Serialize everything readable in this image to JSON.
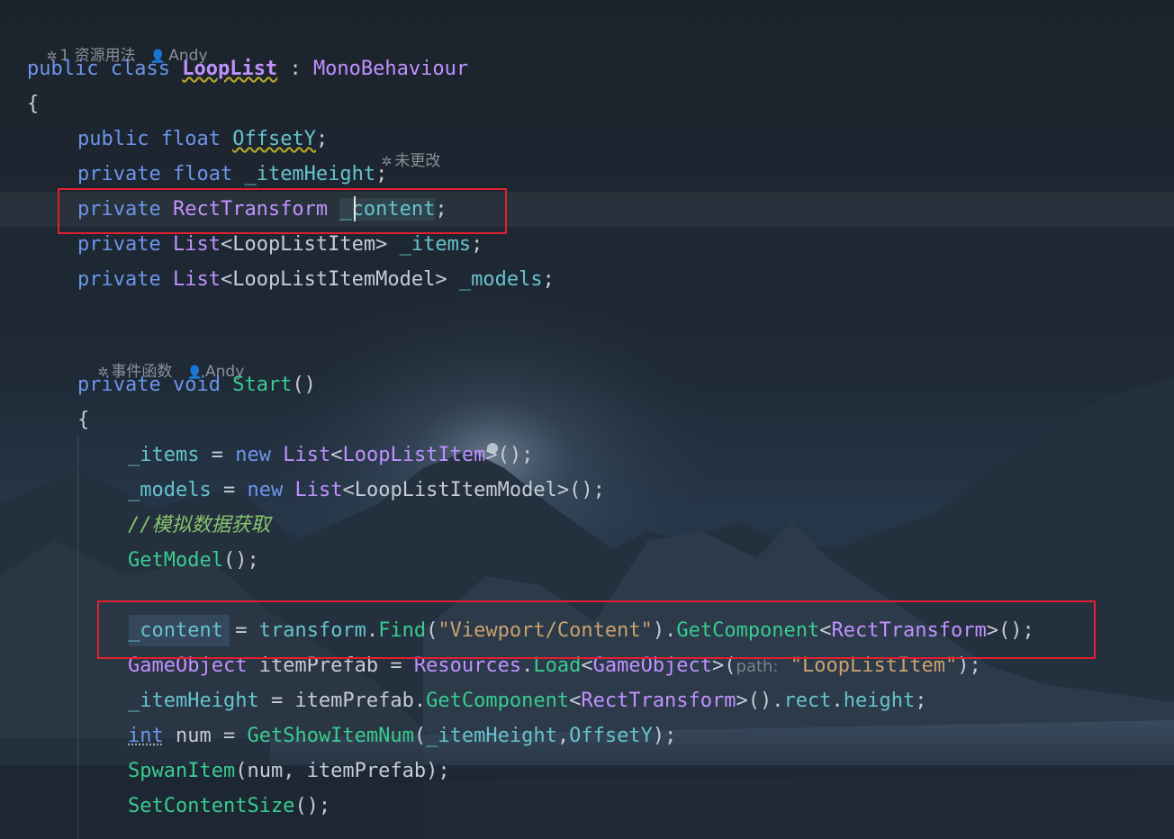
{
  "hints": {
    "class_usages": "1 资源用法",
    "class_author": "Andy",
    "offset_status": "未更改",
    "event_label": "事件函数",
    "event_author": "Andy",
    "param_name": "path:"
  },
  "code": {
    "l1": [
      "public",
      "class",
      "LoopList",
      ":",
      "MonoBehaviour"
    ],
    "l2": "{",
    "l3": [
      "public",
      "float",
      "OffsetY",
      ";"
    ],
    "l4": [
      "private",
      "float",
      "_itemHeight",
      ";"
    ],
    "l5": [
      "private",
      "RectTransform",
      "_content",
      ";"
    ],
    "l6": [
      "private",
      "List",
      "<",
      "LoopListItem",
      ">",
      "_items",
      ";"
    ],
    "l7": [
      "private",
      "List",
      "<",
      "LoopListItemModel",
      ">",
      "_models",
      ";"
    ],
    "l8": [
      "private",
      "void",
      "Start",
      "()"
    ],
    "l9": "{",
    "l10": [
      "_items",
      " = ",
      "new",
      "List",
      "<",
      "LoopListItem",
      ">();"
    ],
    "l11": [
      "_models",
      " = ",
      "new",
      "List",
      "<",
      "LoopListItemModel",
      ">();"
    ],
    "l12": "//模拟数据获取",
    "l13": [
      "GetModel",
      "();"
    ],
    "l14": [
      "_content",
      " = ",
      "transform",
      ".",
      "Find",
      "(",
      "\"Viewport/Content\"",
      ").",
      "GetComponent",
      "<",
      "RectTransform",
      ">();"
    ],
    "l15": [
      "GameObject",
      " itemPrefab = ",
      "Resources",
      ".",
      "Load",
      "<",
      "GameObject",
      ">(",
      "\"LoopListItem\"",
      ");"
    ],
    "l16": [
      "_itemHeight",
      " = itemPrefab.",
      "GetComponent",
      "<",
      "RectTransform",
      ">().",
      "rect",
      ".",
      "height",
      ";"
    ],
    "l17": [
      "int",
      " num = ",
      "GetShowItemNum",
      "(",
      "_itemHeight",
      ",",
      "OffsetY",
      ");"
    ],
    "l18": [
      "SpwanItem",
      "(num, itemPrefab);"
    ],
    "l19": [
      "SetContentSize",
      "();"
    ]
  },
  "colors": {
    "keyword": "#6c95eb",
    "class": "#c191ff",
    "field": "#66c3cc",
    "method": "#39cc8f",
    "string": "#c9a26d",
    "comment": "#85c46c",
    "highlight_box": "#e02030"
  },
  "icons": {
    "usage_icon": "unity-icon",
    "author_icon": "person-icon",
    "status_icon": "unity-icon",
    "event_icon": "unity-icon"
  }
}
